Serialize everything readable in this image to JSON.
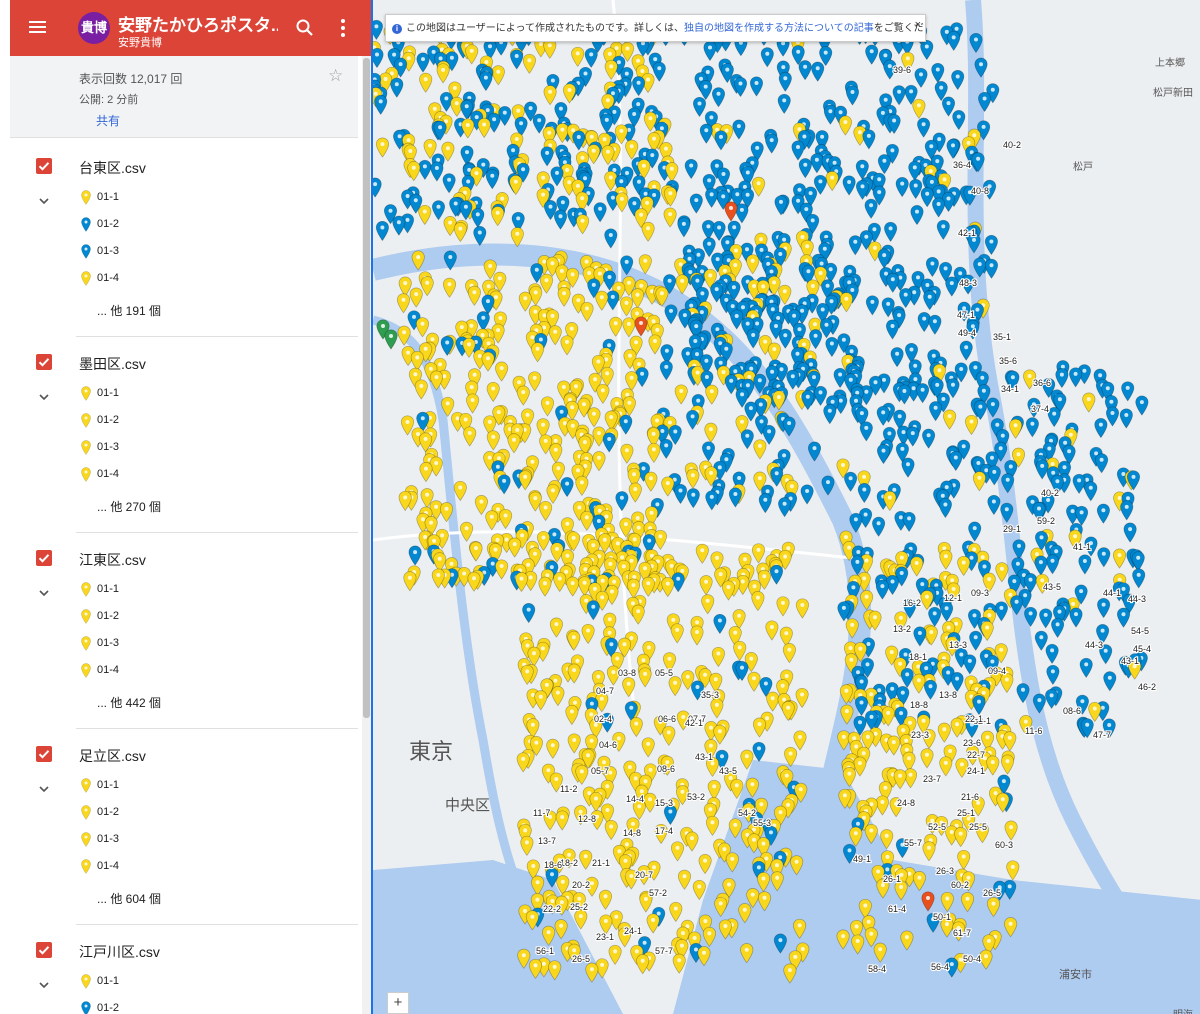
{
  "header": {
    "avatar_text": "貴博",
    "title": "安野たかひろポスタ...",
    "owner": "安野貴博",
    "bar_color": "#db4437"
  },
  "info": {
    "views": "表示回数 12,017 回",
    "published": "公開: 2 分前",
    "share": "共有"
  },
  "layers": [
    {
      "name": "台東区.csv",
      "checked": true,
      "features": [
        {
          "label": "01-1",
          "color": "yellow"
        },
        {
          "label": "01-2",
          "color": "blue"
        },
        {
          "label": "01-3",
          "color": "blue"
        },
        {
          "label": "01-4",
          "color": "yellow"
        }
      ],
      "more": "... 他 191 個"
    },
    {
      "name": "墨田区.csv",
      "checked": true,
      "features": [
        {
          "label": "01-1",
          "color": "yellow"
        },
        {
          "label": "01-2",
          "color": "yellow"
        },
        {
          "label": "01-3",
          "color": "yellow"
        },
        {
          "label": "01-4",
          "color": "yellow"
        }
      ],
      "more": "... 他 270 個"
    },
    {
      "name": "江東区.csv",
      "checked": true,
      "features": [
        {
          "label": "01-1",
          "color": "yellow"
        },
        {
          "label": "01-2",
          "color": "yellow"
        },
        {
          "label": "01-3",
          "color": "yellow"
        },
        {
          "label": "01-4",
          "color": "yellow"
        }
      ],
      "more": "... 他 442 個"
    },
    {
      "name": "足立区.csv",
      "checked": true,
      "features": [
        {
          "label": "01-1",
          "color": "yellow"
        },
        {
          "label": "01-2",
          "color": "yellow"
        },
        {
          "label": "01-3",
          "color": "yellow"
        },
        {
          "label": "01-4",
          "color": "yellow"
        }
      ],
      "more": "... 他 604 個"
    },
    {
      "name": "江戸川区.csv",
      "checked": true,
      "features": [
        {
          "label": "01-1",
          "color": "yellow"
        },
        {
          "label": "01-2",
          "color": "blue"
        }
      ],
      "more": ""
    }
  ],
  "map": {
    "notice_prefix": "この地図はユーザーによって作成されたものです。詳しくは、",
    "notice_link": "独自の地図を作成する方法についての記事",
    "notice_suffix": "をご覧ください。",
    "close_glyph": "×",
    "zoom_in": "+",
    "places": [
      {
        "name": "東京",
        "kind": "large"
      },
      {
        "name": "中央区",
        "kind": "medium"
      },
      {
        "name": "浦安市",
        "kind": "small"
      },
      {
        "name": "松戸",
        "kind": "small"
      },
      {
        "name": "上本郷",
        "kind": "small"
      },
      {
        "name": "松戸新田",
        "kind": "small"
      },
      {
        "name": "明海",
        "kind": "small"
      }
    ],
    "pin_labels": [
      "39-6",
      "40-2",
      "40-8",
      "42-1",
      "36-4",
      "48-3",
      "47-1",
      "49-4",
      "35-1",
      "35-6",
      "36-6",
      "37-4",
      "34-1",
      "40-2",
      "59-2",
      "29-1",
      "41-1",
      "44-3",
      "43-5",
      "44-1",
      "54-5",
      "44-3",
      "45-4",
      "43-1",
      "46-2",
      "47-7",
      "08-6",
      "11-6",
      "16-2",
      "12-1",
      "09-3",
      "13-2",
      "18-1",
      "13-3",
      "09-4",
      "13-8",
      "18-8",
      "62-1",
      "22-1",
      "23-3",
      "23-6",
      "22-7",
      "24-1",
      "23-7",
      "21-6",
      "24-8",
      "25-1",
      "52-5",
      "25-5",
      "60-3",
      "49-1",
      "55-7",
      "26-1",
      "26-3",
      "60-2",
      "26-5",
      "61-4",
      "50-1",
      "61-7",
      "58-4",
      "56-4",
      "50-4",
      "03-8",
      "05-5",
      "04-7",
      "35-3",
      "02-4",
      "06-6",
      "07-7",
      "42-1",
      "04-6",
      "05-7",
      "08-6",
      "43-1",
      "43-5",
      "11-2",
      "14-4",
      "15-3",
      "53-2",
      "11-7",
      "12-8",
      "54-2",
      "55-3",
      "13-7",
      "14-8",
      "17-4",
      "18-2",
      "21-1",
      "18-6",
      "20-2",
      "20-7",
      "57-2",
      "22-2",
      "25-2",
      "24-1",
      "23-1",
      "26-5",
      "57-7",
      "56-1"
    ],
    "colors": {
      "yellow": "#f9d71c",
      "blue": "#0288d1",
      "red": "#e8501d",
      "green": "#2e9d4f",
      "water": "#aecbf0",
      "land": "#eceff1"
    }
  }
}
